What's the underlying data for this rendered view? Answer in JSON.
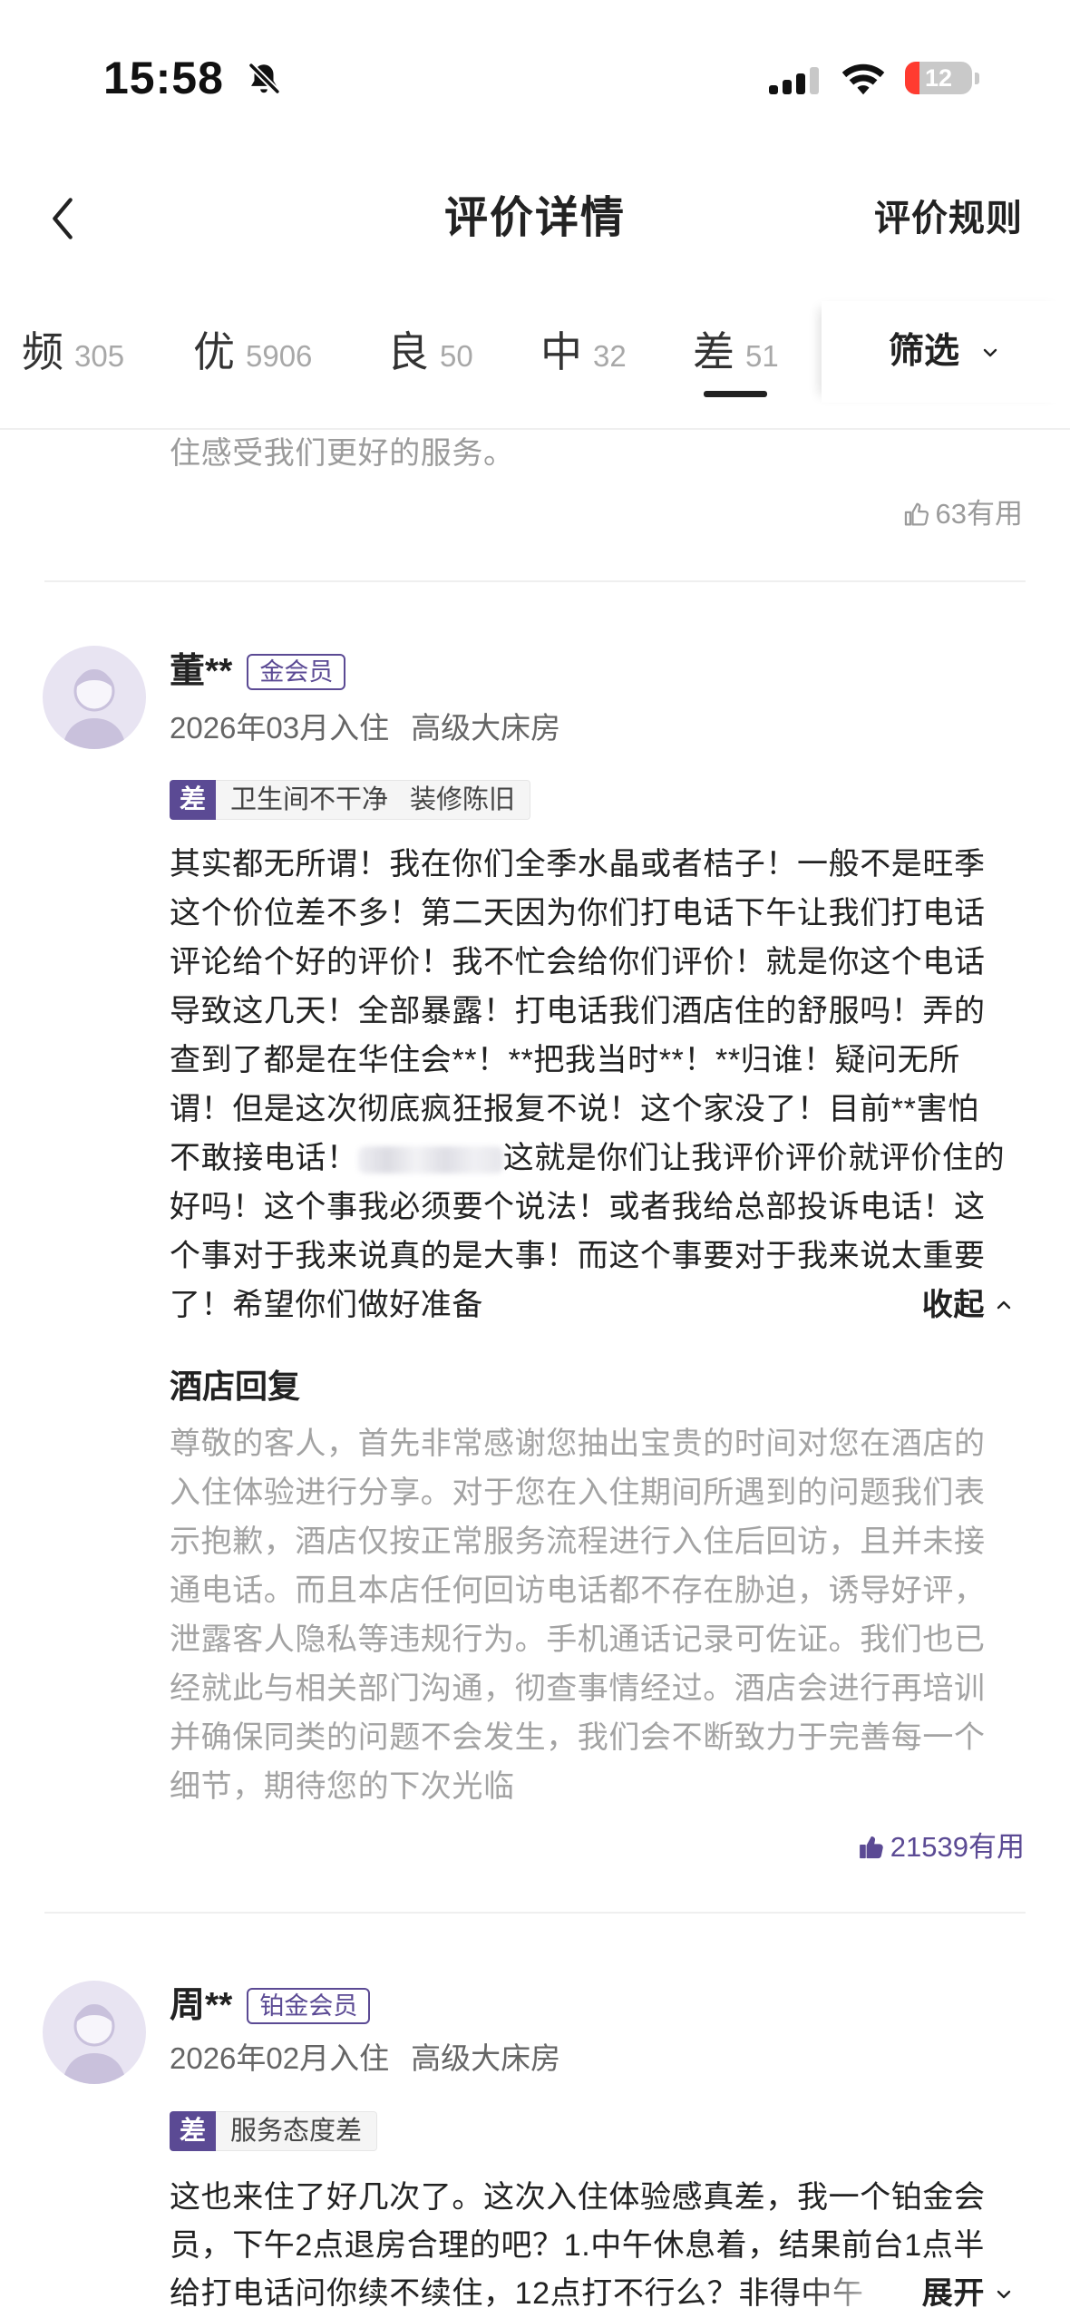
{
  "status_bar": {
    "time": "15:58",
    "battery": "12"
  },
  "header": {
    "title": "评价详情",
    "rules_link": "评价规则"
  },
  "tabs": [
    {
      "label": "频",
      "count": "305"
    },
    {
      "label": "优",
      "count": "5906"
    },
    {
      "label": "良",
      "count": "50"
    },
    {
      "label": "中",
      "count": "32"
    },
    {
      "label": "差",
      "count": "51",
      "selected": true
    }
  ],
  "filter_label": "筛选",
  "previous_review": {
    "reply_tail": "住感受我们更好的服务。",
    "helpful": "63有用"
  },
  "reviews": [
    {
      "name": "董**",
      "member": "金会员",
      "stay": "2026年03月入住",
      "room": "高级大床房",
      "rating": "差",
      "tags": [
        "卫生间不干净",
        "装修陈旧"
      ],
      "body_lines": [
        "其实都无所谓！我在你们全季水晶或者桔子！一般不是旺季",
        "这个价位差不多！第二天因为你们打电话下午让我们打电话",
        "评论给个好的评价！我不忙会给你们评价！就是你这个电话",
        "导致这几天！全部暴露！打电话我们酒店住的舒服吗！弄的",
        "查到了都是在华住会**！**把我当时**！**归谁！疑问无所",
        "谓！但是这次彻底疯狂报复不说！这个家没了！目前**害怕",
        {
          "before": "不敢接电话！",
          "after": "这就是你们让我评价评价就评价住的"
        },
        "好吗！这个事我必须要个说法！或者我给总部投诉电话！这",
        "个事对于我来说真的是大事！而这个事要对于我来说太重要",
        "了！希望你们做好准备"
      ],
      "toggle": "收起",
      "reply_title": "酒店回复",
      "reply_lines": [
        "尊敬的客人，首先非常感谢您抽出宝贵的时间对您在酒店的",
        "入住体验进行分享。对于您在入住期间所遇到的问题我们表",
        "示抱歉，酒店仅按正常服务流程进行入住后回访，且并未接",
        "通电话。而且本店任何回访电话都不存在胁迫，诱导好评，",
        "泄露客人隐私等违规行为。手机通话记录可佐证。我们也已",
        "经就此与相关部门沟通，彻查事情经过。酒店会进行再培训",
        "并确保同类的问题不会发生，我们会不断致力于完善每一个",
        "细节，期待您的下次光临"
      ],
      "helpful": "21539有用",
      "helpful_liked": true
    },
    {
      "name": "周**",
      "member": "铂金会员",
      "stay": "2026年02月入住",
      "room": "高级大床房",
      "rating": "差",
      "tags": [
        "服务态度差"
      ],
      "body_lines": [
        "这也来住了好几次了。这次入住体验感真差，我一个铂金会",
        "员，下午2点退房合理的吧？1.中午休息着，结果前台1点半",
        "给打电话问你续不续住，12点打不行么？非得中午"
      ],
      "toggle": "展开"
    }
  ],
  "icons": {
    "status": [
      "bell-slash-icon",
      "cellular-signal-icon",
      "wifi-icon",
      "battery-icon"
    ],
    "header": [
      "back-chevron-icon"
    ],
    "filter": "chevron-down-icon",
    "helpful": "thumbs-up-icon",
    "avatar": "default-user-avatar"
  },
  "colors": {
    "accent": "#5b4a94",
    "battery_low": "#ff3b30",
    "muted_text": "#9b9b9b",
    "reply_text": "#a3a3a3"
  }
}
